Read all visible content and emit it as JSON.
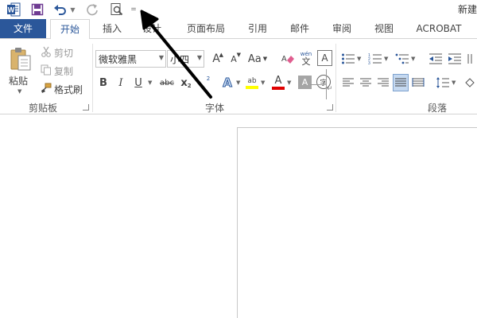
{
  "qat": {
    "more_symbol": "=",
    "undo_dropdown_symbol": "▼",
    "logo_letter": "W"
  },
  "window": {
    "title": "新建"
  },
  "tabs": [
    {
      "label": "文件"
    },
    {
      "label": "开始"
    },
    {
      "label": "插入"
    },
    {
      "label": "设计"
    },
    {
      "label": "页面布局"
    },
    {
      "label": "引用"
    },
    {
      "label": "邮件"
    },
    {
      "label": "审阅"
    },
    {
      "label": "视图"
    },
    {
      "label": "ACROBAT"
    }
  ],
  "clipboard": {
    "paste": "粘贴",
    "cut": "剪切",
    "copy": "复制",
    "format_painter": "格式刷",
    "group_label": "剪贴板"
  },
  "font": {
    "font_name": "微软雅黑",
    "font_size": "小四",
    "grow": "A",
    "shrink": "A",
    "change_case": "Aa",
    "wen_top": "wén",
    "wen_char": "文",
    "bold": "B",
    "italic": "I",
    "underline": "U",
    "strikethrough": "abc",
    "subscript": "x",
    "subscript_mark": "2",
    "superscript_mark": "2",
    "highlight_letter": "ab",
    "font_color_letter": "A",
    "char_shading_letter": "A",
    "enclose_char": "字",
    "group_label": "字体"
  },
  "paragraph": {
    "group_label": "段落"
  },
  "colors": {
    "file_tab": "#2b579a",
    "highlight": "#ffff00",
    "font_color": "#e00000",
    "accent": "#2b579a"
  },
  "icons": {
    "logo": "word-logo-icon",
    "save": "save-icon",
    "undo": "undo-icon",
    "redo": "redo-icon",
    "preview": "print-preview-icon",
    "annotation": "annotation-arrow"
  }
}
